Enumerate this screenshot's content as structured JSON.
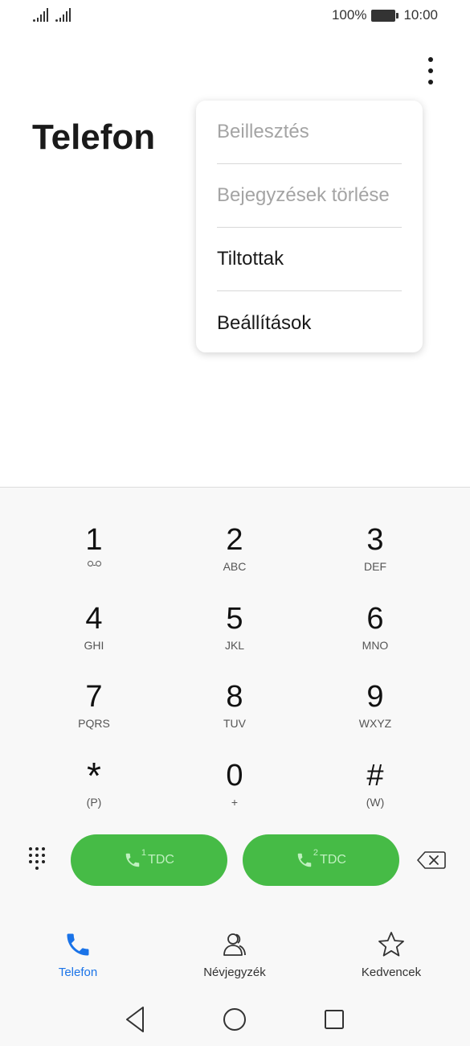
{
  "status_bar": {
    "battery_percent": "100%",
    "time": "10:00"
  },
  "header": {
    "title": "Telefon"
  },
  "menu": {
    "items": [
      {
        "label": "Beillesztés",
        "enabled": false
      },
      {
        "label": "Bejegyzések törlése",
        "enabled": false
      },
      {
        "label": "Tiltottak",
        "enabled": true
      },
      {
        "label": "Beállítások",
        "enabled": true
      }
    ]
  },
  "dialpad": {
    "keys": [
      {
        "num": "1",
        "sub": ""
      },
      {
        "num": "2",
        "sub": "ABC"
      },
      {
        "num": "3",
        "sub": "DEF"
      },
      {
        "num": "4",
        "sub": "GHI"
      },
      {
        "num": "5",
        "sub": "JKL"
      },
      {
        "num": "6",
        "sub": "MNO"
      },
      {
        "num": "7",
        "sub": "PQRS"
      },
      {
        "num": "8",
        "sub": "TUV"
      },
      {
        "num": "9",
        "sub": "WXYZ"
      },
      {
        "num": "*",
        "sub": "(P)"
      },
      {
        "num": "0",
        "sub": "+"
      },
      {
        "num": "#",
        "sub": "(W)"
      }
    ]
  },
  "call_buttons": [
    {
      "sim": "1",
      "label": "TDC"
    },
    {
      "sim": "2",
      "label": "TDC"
    }
  ],
  "bottom_nav": {
    "tabs": [
      {
        "label": "Telefon",
        "icon": "phone-icon",
        "active": true
      },
      {
        "label": "Névjegyzék",
        "icon": "contacts-icon",
        "active": false
      },
      {
        "label": "Kedvencek",
        "icon": "star-icon",
        "active": false
      }
    ]
  },
  "colors": {
    "accent": "#1a73e8",
    "call_green": "#46bb46"
  }
}
